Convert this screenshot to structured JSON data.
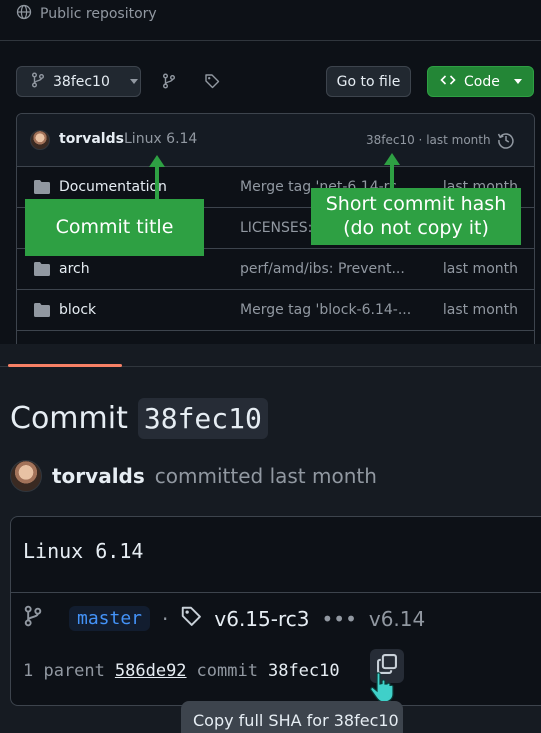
{
  "repo": {
    "visibility_label": "Public repository"
  },
  "toolbar": {
    "branch_label": "38fec10",
    "goto_file_label": "Go to file",
    "code_label": "Code"
  },
  "latest_commit": {
    "author": "torvalds",
    "title": "Linux 6.14",
    "meta": "38fec10 · last month"
  },
  "files": [
    {
      "name": "Documentation",
      "message": "Merge tag 'net-6.14-rc",
      "date": "last month"
    },
    {
      "name": "",
      "message": "LICENSES: ",
      "date": ""
    },
    {
      "name": "arch",
      "message": "perf/amd/ibs: Prevent...",
      "date": "last month"
    },
    {
      "name": "block",
      "message": "Merge tag 'block-6.14-...",
      "date": "last month"
    }
  ],
  "callouts": {
    "commit_title": "Commit title",
    "short_hash": "Short commit hash\n(do not copy it)"
  },
  "commit_page": {
    "heading_prefix": "Commit",
    "heading_sha": "38fec10",
    "author": "torvalds",
    "committed_text": "committed last month",
    "message": "Linux 6.14",
    "branch": "master",
    "tag": "v6.15-rc3",
    "ellipsis": "•••",
    "tag2": "v6.14",
    "parent_prefix": "1 parent",
    "parent_sha": "586de92",
    "commit_word": "commit",
    "commit_sha": "38fec10",
    "tooltip": "Copy full SHA for 38fec10"
  },
  "colors": {
    "accent_green": "#2ea043",
    "link_blue": "#4493f8",
    "tab_underline": "#f78166"
  }
}
